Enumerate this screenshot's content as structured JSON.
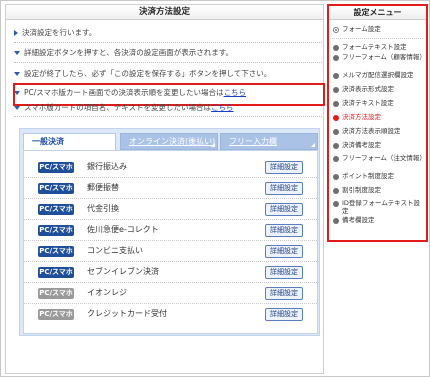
{
  "main": {
    "title": "決済方法設定",
    "intro": "決済設定を行います。",
    "notes": [
      "詳細設定ボタンを押すと、各決済の設定画面が表示されます。",
      "設定が終了したら、必ず「この設定を保存する」ボタンを押して下さい。"
    ],
    "pc_link_text": "PC/スマホ版カート画面での決済表示順を変更したい場合は",
    "pc_link_anchor": "こちら",
    "sp_link_text": "スマホ版カートの項目名、テキストを変更したい場合は",
    "sp_link_anchor": "こちら"
  },
  "tabs": [
    {
      "label": "一般決済",
      "active": true
    },
    {
      "label": "オンライン決済(後払い)",
      "active": false
    },
    {
      "label": "フリー入力欄",
      "active": false
    }
  ],
  "payments": [
    {
      "badge": "PC/スマホ",
      "badge_style": "blue",
      "label": "銀行振込み",
      "button": "詳細設定"
    },
    {
      "badge": "PC/スマホ",
      "badge_style": "blue",
      "label": "郵便振替",
      "button": "詳細設定"
    },
    {
      "badge": "PC/スマホ",
      "badge_style": "blue",
      "label": "代金引換",
      "button": "詳細設定"
    },
    {
      "badge": "PC/スマホ",
      "badge_style": "blue",
      "label": "佐川急便e-コレクト",
      "button": "詳細設定"
    },
    {
      "badge": "PC/スマホ",
      "badge_style": "blue",
      "label": "コンビニ支払い",
      "button": "詳細設定"
    },
    {
      "badge": "PC/スマホ",
      "badge_style": "blue",
      "label": "セブンイレブン決済",
      "button": "詳細設定"
    },
    {
      "badge": "PC/スマホ",
      "badge_style": "grey",
      "label": "イオンレジ",
      "button": "詳細設定"
    },
    {
      "badge": "PC/スマホ",
      "badge_style": "grey",
      "label": "クレジットカード受付",
      "button": "詳細設定"
    }
  ],
  "sidebar": {
    "title": "設定メニュー",
    "top_item": "フォーム設定",
    "items": [
      {
        "label": "フォームテキスト設定",
        "active": false
      },
      {
        "label": "フリーフォーム（顧客情報）",
        "active": false
      },
      {
        "label": "メルマガ配信選択欄設定",
        "active": false
      },
      {
        "label": "決済表示形式設定",
        "active": false
      },
      {
        "label": "決済テキスト設定",
        "active": false
      },
      {
        "label": "決済方法設定",
        "active": true
      },
      {
        "label": "決済方法表示順設定",
        "active": false
      },
      {
        "label": "決済備考設定",
        "active": false
      },
      {
        "label": "フリーフォーム（注文情報）",
        "active": false
      },
      {
        "label": "ポイント制度設定",
        "active": false
      },
      {
        "label": "割引制度設定",
        "active": false
      },
      {
        "label": "ID登録フォームテキスト設定",
        "active": false
      },
      {
        "label": "備考欄設定",
        "active": false
      }
    ]
  },
  "colors": {
    "accent_blue": "#1f4f9a",
    "highlight_red": "#e21b1b",
    "tab_bg": "#dce8f7"
  }
}
